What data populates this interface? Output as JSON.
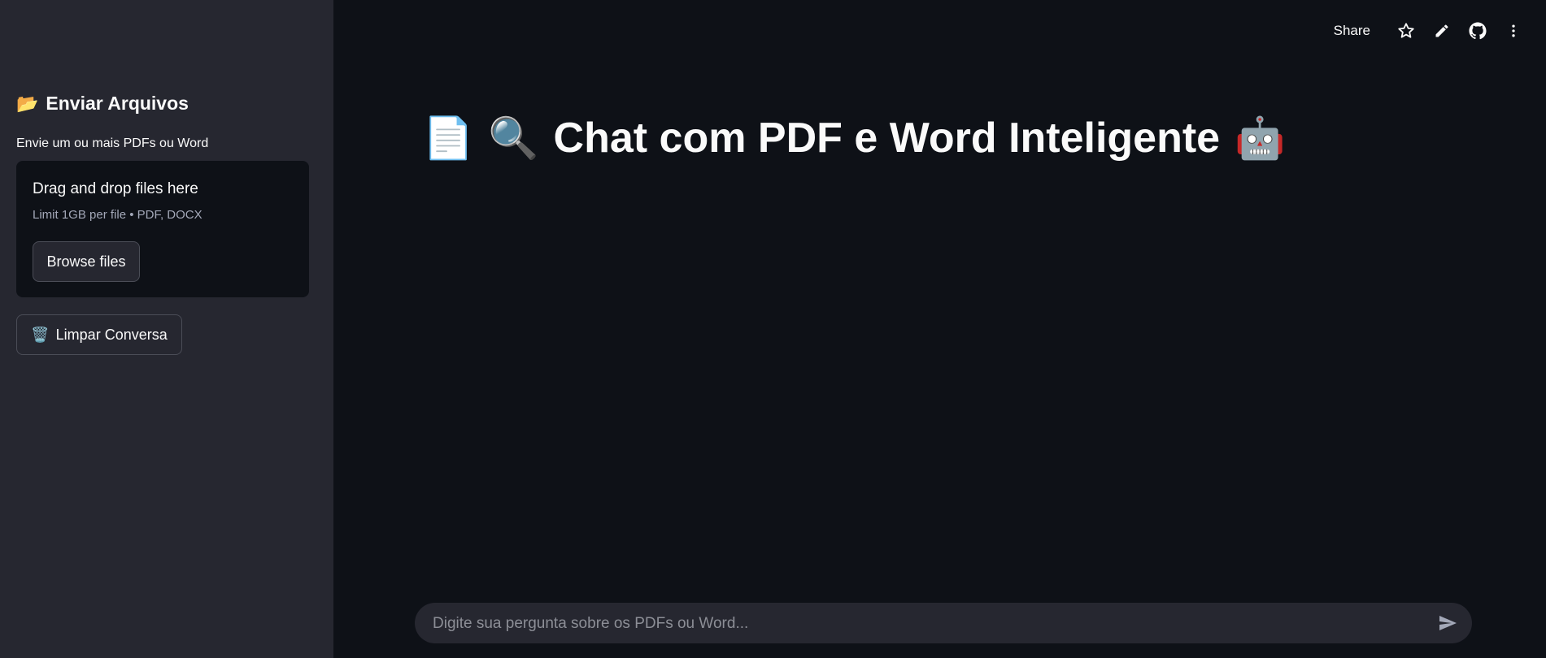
{
  "sidebar": {
    "title_emoji": "📂",
    "title": "Enviar Arquivos",
    "uploader_label": "Envie um ou mais PDFs ou Word",
    "dropzone": {
      "title": "Drag and drop files here",
      "limits": "Limit 1GB per file • PDF, DOCX",
      "browse_label": "Browse files"
    },
    "clear_button": {
      "emoji": "🗑️",
      "label": "Limpar Conversa"
    }
  },
  "toolbar": {
    "share_label": "Share",
    "icons": [
      "star-icon",
      "pencil-icon",
      "github-icon",
      "more-vertical-icon"
    ]
  },
  "main": {
    "title_emojis": [
      "📄",
      "🔍",
      "🤖"
    ],
    "title": "Chat com PDF e Word Inteligente"
  },
  "chat": {
    "placeholder": "Digite sua pergunta sobre os PDFs ou Word..."
  },
  "colors": {
    "background": "#0e1117",
    "sidebar": "#262730",
    "text": "#fafafa",
    "muted": "#a3a8b8"
  }
}
